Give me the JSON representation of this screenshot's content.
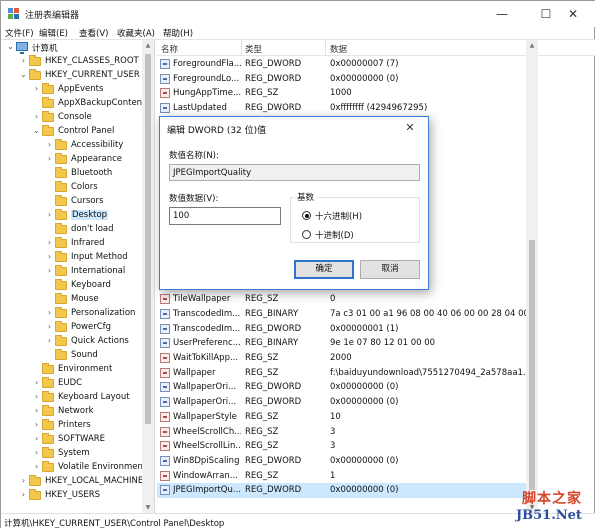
{
  "window": {
    "title": "注册表编辑器",
    "minimize": "—",
    "maximize": "☐",
    "close": "✕"
  },
  "menu": [
    "文件(F)",
    "编辑(E)",
    "查看(V)",
    "收藏夹(A)",
    "帮助(H)"
  ],
  "tree": [
    {
      "label": "计算机",
      "icon": "computer-icon",
      "arrow": "⌄",
      "level": 0
    },
    {
      "label": "HKEY_CLASSES_ROOT",
      "icon": "folder-icon",
      "arrow": "›",
      "level": 1
    },
    {
      "label": "HKEY_CURRENT_USER",
      "icon": "folder-icon",
      "arrow": "⌄",
      "level": 1
    },
    {
      "label": "AppEvents",
      "icon": "folder-icon",
      "arrow": "›",
      "level": 2
    },
    {
      "label": "AppXBackupContentType",
      "icon": "folder-icon",
      "arrow": "",
      "level": 2
    },
    {
      "label": "Console",
      "icon": "folder-icon",
      "arrow": "›",
      "level": 2
    },
    {
      "label": "Control Panel",
      "icon": "folder-icon",
      "arrow": "⌄",
      "level": 2
    },
    {
      "label": "Accessibility",
      "icon": "folder-icon",
      "arrow": "›",
      "level": 3
    },
    {
      "label": "Appearance",
      "icon": "folder-icon",
      "arrow": "›",
      "level": 3
    },
    {
      "label": "Bluetooth",
      "icon": "folder-icon",
      "arrow": "",
      "level": 3
    },
    {
      "label": "Colors",
      "icon": "folder-icon",
      "arrow": "",
      "level": 3
    },
    {
      "label": "Cursors",
      "icon": "folder-icon",
      "arrow": "",
      "level": 3
    },
    {
      "label": "Desktop",
      "icon": "folder-icon",
      "arrow": "›",
      "level": 3,
      "selected": true
    },
    {
      "label": "don't load",
      "icon": "folder-icon",
      "arrow": "",
      "level": 3
    },
    {
      "label": "Infrared",
      "icon": "folder-icon",
      "arrow": "›",
      "level": 3
    },
    {
      "label": "Input Method",
      "icon": "folder-icon",
      "arrow": "›",
      "level": 3
    },
    {
      "label": "International",
      "icon": "folder-icon",
      "arrow": "›",
      "level": 3
    },
    {
      "label": "Keyboard",
      "icon": "folder-icon",
      "arrow": "",
      "level": 3
    },
    {
      "label": "Mouse",
      "icon": "folder-icon",
      "arrow": "",
      "level": 3
    },
    {
      "label": "Personalization",
      "icon": "folder-icon",
      "arrow": "›",
      "level": 3
    },
    {
      "label": "PowerCfg",
      "icon": "folder-icon",
      "arrow": "›",
      "level": 3
    },
    {
      "label": "Quick Actions",
      "icon": "folder-icon",
      "arrow": "›",
      "level": 3
    },
    {
      "label": "Sound",
      "icon": "folder-icon",
      "arrow": "",
      "level": 3
    },
    {
      "label": "Environment",
      "icon": "folder-icon",
      "arrow": "",
      "level": 2
    },
    {
      "label": "EUDC",
      "icon": "folder-icon",
      "arrow": "›",
      "level": 2
    },
    {
      "label": "Keyboard Layout",
      "icon": "folder-icon",
      "arrow": "›",
      "level": 2
    },
    {
      "label": "Network",
      "icon": "folder-icon",
      "arrow": "›",
      "level": 2
    },
    {
      "label": "Printers",
      "icon": "folder-icon",
      "arrow": "›",
      "level": 2
    },
    {
      "label": "SOFTWARE",
      "icon": "folder-icon",
      "arrow": "›",
      "level": 2
    },
    {
      "label": "System",
      "icon": "folder-icon",
      "arrow": "›",
      "level": 2
    },
    {
      "label": "Volatile Environment",
      "icon": "folder-icon",
      "arrow": "›",
      "level": 2
    },
    {
      "label": "HKEY_LOCAL_MACHINE",
      "icon": "folder-icon",
      "arrow": "›",
      "level": 1
    },
    {
      "label": "HKEY_USERS",
      "icon": "folder-icon",
      "arrow": "›",
      "level": 1
    }
  ],
  "list": {
    "headers": {
      "name": "名称",
      "type": "类型",
      "data": "数据"
    },
    "rows": [
      {
        "name": "ForegroundFla...",
        "type": "REG_DWORD",
        "data": "0x00000007 (7)",
        "icon": "dword"
      },
      {
        "name": "ForegroundLo...",
        "type": "REG_DWORD",
        "data": "0x00000000 (0)",
        "icon": "dword"
      },
      {
        "name": "HungAppTime...",
        "type": "REG_SZ",
        "data": "1000",
        "icon": "sz"
      },
      {
        "name": "LastUpdated",
        "type": "REG_DWORD",
        "data": "0xffffffff (4294967295)",
        "icon": "dword"
      },
      {
        "name": "",
        "type": "",
        "data": "",
        "icon": "none"
      },
      {
        "name": "",
        "type": "",
        "data": "",
        "icon": "none"
      },
      {
        "name": "",
        "type": "",
        "data": "",
        "icon": "none"
      },
      {
        "name": "",
        "type": "",
        "data": "",
        "icon": "none"
      },
      {
        "name": "",
        "type": "",
        "data": "",
        "icon": "none"
      },
      {
        "name": "",
        "type": "",
        "data": "",
        "icon": "none"
      },
      {
        "name": "",
        "type": "",
        "data": "",
        "icon": "none"
      },
      {
        "name": "",
        "type": "",
        "data": "",
        "icon": "none"
      },
      {
        "name": "",
        "type": "",
        "data": "",
        "icon": "none"
      },
      {
        "name": "",
        "type": "",
        "data": "",
        "icon": "none"
      },
      {
        "name": "",
        "type": "",
        "data": "",
        "icon": "none"
      },
      {
        "name": "",
        "type": "",
        "data": "",
        "icon": "none"
      },
      {
        "name": "TileWallpaper",
        "type": "REG_SZ",
        "data": "0",
        "icon": "sz"
      },
      {
        "name": "TranscodedIm...",
        "type": "REG_BINARY",
        "data": "7a c3 01 00 a1 96 08 00 40 06 00 00 28 04 00...",
        "icon": "dword"
      },
      {
        "name": "TranscodedIm...",
        "type": "REG_DWORD",
        "data": "0x00000001 (1)",
        "icon": "dword"
      },
      {
        "name": "UserPreferenc...",
        "type": "REG_BINARY",
        "data": "9e 1e 07 80 12 01 00 00",
        "icon": "dword"
      },
      {
        "name": "WaitToKillApp...",
        "type": "REG_SZ",
        "data": "2000",
        "icon": "sz"
      },
      {
        "name": "Wallpaper",
        "type": "REG_SZ",
        "data": "f:\\baiduyundownload\\7551270494_2a578aa1...",
        "icon": "sz"
      },
      {
        "name": "WallpaperOri...",
        "type": "REG_DWORD",
        "data": "0x00000000 (0)",
        "icon": "dword"
      },
      {
        "name": "WallpaperOri...",
        "type": "REG_DWORD",
        "data": "0x00000000 (0)",
        "icon": "dword"
      },
      {
        "name": "WallpaperStyle",
        "type": "REG_SZ",
        "data": "10",
        "icon": "sz"
      },
      {
        "name": "WheelScrollCh...",
        "type": "REG_SZ",
        "data": "3",
        "icon": "sz"
      },
      {
        "name": "WheelScrollLin...",
        "type": "REG_SZ",
        "data": "3",
        "icon": "sz"
      },
      {
        "name": "Win8DpiScaling",
        "type": "REG_DWORD",
        "data": "0x00000000 (0)",
        "icon": "dword"
      },
      {
        "name": "WindowArran...",
        "type": "REG_SZ",
        "data": "1",
        "icon": "sz"
      },
      {
        "name": "JPEGImportQu...",
        "type": "REG_DWORD",
        "data": "0x00000000 (0)",
        "icon": "dword",
        "selected": true
      }
    ]
  },
  "status": "计算机\\HKEY_CURRENT_USER\\Control Panel\\Desktop",
  "watermark": {
    "top": "脚本之家",
    "bottom": "JB51.Net"
  },
  "dialog": {
    "title": "编辑 DWORD (32 位)值",
    "close": "✕",
    "name_label": "数值名称(N):",
    "name_value": "JPEGImportQuality",
    "data_label": "数值数据(V):",
    "data_value": "100",
    "base_label": "基数",
    "hex_label": "十六进制(H)",
    "dec_label": "十进制(D)",
    "hex_checked": true,
    "ok": "确定",
    "cancel": "取消"
  },
  "colors": {
    "selection": "#cce8ff",
    "accent": "#2f74d0",
    "folder": "#f1c84c"
  }
}
